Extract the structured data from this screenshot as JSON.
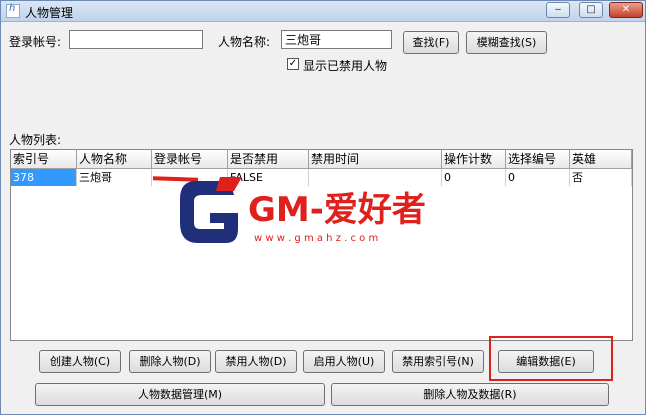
{
  "window": {
    "title": "人物管理",
    "controls": {
      "minimize": "‒",
      "maximize": "□",
      "close": "✕"
    }
  },
  "search": {
    "account_label": "登录帐号:",
    "account_value": "",
    "name_label": "人物名称:",
    "name_value": "三炮哥",
    "find_button": "查找(F)",
    "fuzzy_find_button": "模糊查找(S)",
    "show_banned_checked": true,
    "show_banned_label": "显示已禁用人物"
  },
  "list": {
    "label": "人物列表:",
    "columns": [
      "索引号",
      "人物名称",
      "登录帐号",
      "是否禁用",
      "禁用时间",
      "操作计数",
      "选择编号",
      "英雄"
    ],
    "rows": [
      [
        "378",
        "三炮哥",
        "",
        "FALSE",
        "",
        "0",
        "0",
        "否"
      ]
    ]
  },
  "watermark": {
    "logo_text": "GM-爱好者",
    "url_text": "w w w . g m a h z . c o m"
  },
  "actions": {
    "create": "创建人物(C)",
    "delete": "删除人物(D)",
    "ban": "禁用人物(D)",
    "enable": "启用人物(U)",
    "ban_index": "禁用索引号(N)",
    "edit": "编辑数据(E)",
    "data_manage": "人物数据管理(M)",
    "delete_with_data": "删除人物及数据(R)"
  },
  "colors": {
    "selection": "#3399ff",
    "watermark_red": "#e0201c",
    "watermark_navy": "#1f2f7a"
  }
}
